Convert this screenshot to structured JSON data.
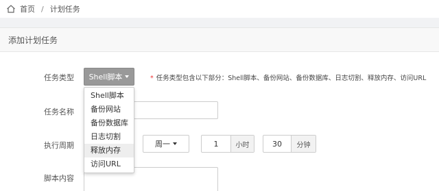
{
  "breadcrumb": {
    "home": "首页",
    "separator": "/",
    "current": "计划任务"
  },
  "panel": {
    "title": "添加计划任务"
  },
  "form": {
    "task_type_label": "任务类型",
    "task_type_value": "Shell脚本",
    "task_type_hint_star": "*",
    "task_type_hint": "任务类型包含以下部分：Shell脚本、备份网站、备份数据库、日志切割、释放内存、访问URL",
    "task_type_options": [
      "Shell脚本",
      "备份网站",
      "备份数据库",
      "日志切割",
      "释放内存",
      "访问URL"
    ],
    "hovered_option": "释放内存",
    "task_name_label": "任务名称",
    "task_name_value": "",
    "period_label": "执行周期",
    "period_week": "周一",
    "period_hour": "1",
    "period_hour_unit": "小时",
    "period_minute": "30",
    "period_minute_unit": "分钟",
    "script_label": "脚本内容"
  },
  "icons": {
    "home": "home-icon",
    "caret": "caret-down-icon"
  }
}
